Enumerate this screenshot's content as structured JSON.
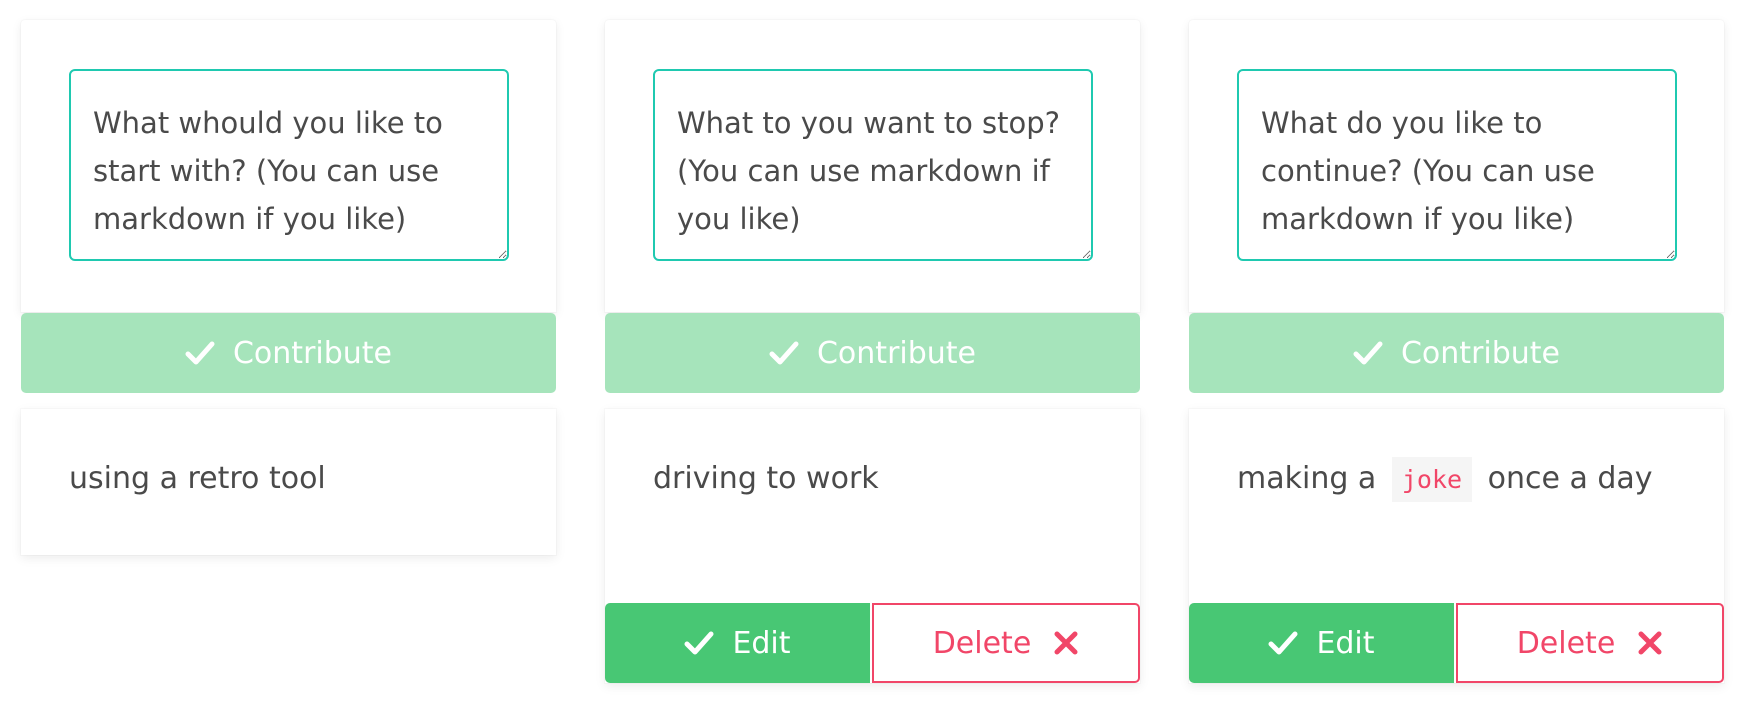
{
  "colors": {
    "accent_teal": "#1fc9b0",
    "contribute_disabled": "#a6e4bb",
    "success_green": "#48c774",
    "danger_pink": "#f14668"
  },
  "columns": [
    {
      "textarea_placeholder": "What whould you like to start with? (You can use markdown if you like)",
      "contribute_label": "Contribute",
      "items": [
        {
          "text": "using a retro tool"
        }
      ]
    },
    {
      "textarea_placeholder": "What to you want to stop? (You can use markdown if you like)",
      "contribute_label": "Contribute",
      "items": [
        {
          "text": "driving to work",
          "edit_label": "Edit",
          "delete_label": "Delete"
        }
      ]
    },
    {
      "textarea_placeholder": "What do you like to continue? (You can use markdown if you like)",
      "contribute_label": "Contribute",
      "items": [
        {
          "text_before": "making a",
          "code": "joke",
          "text_after": "once a day",
          "edit_label": "Edit",
          "delete_label": "Delete"
        }
      ]
    }
  ]
}
